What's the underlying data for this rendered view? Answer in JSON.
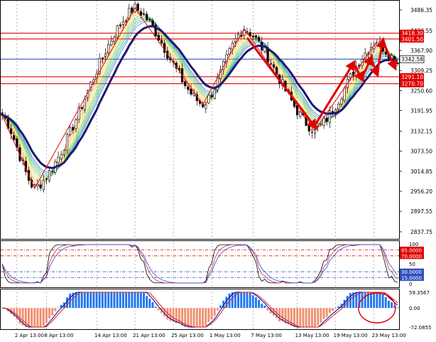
{
  "chart_data": {
    "type": "candlestick",
    "colors": {
      "background": "#ffffff",
      "candle_up": "#ffffff",
      "candle_down": "#000000",
      "candle_outline": "#000000",
      "slow_ma": "#1a1a6e",
      "fan_red": "#e02020",
      "fan_orange": "#ff9a33",
      "fan_yellow": "#e8d13a",
      "fan_green": "#58c24a",
      "fan_teal": "#2ea8a0",
      "fan_blue": "#3d70c8",
      "hline_red": "#e00000",
      "hline_blue": "#3050c0",
      "stoch_main": "#000000",
      "stoch_signal": "#c0304a",
      "stoch_extra": "#4444cc",
      "macd_pos": "#2277ee",
      "macd_neg": "#f09070",
      "macd_line": "#0000aa",
      "macd_signal": "#e02020",
      "annotation": "#e00000"
    },
    "main_panel": {
      "y_ticks": [
        "3486.35",
        "3426.55",
        "3367.90",
        "3309.25",
        "3250.60",
        "3191.95",
        "3132.15",
        "3073.50",
        "3014.85",
        "2956.20",
        "2897.55",
        "2837.75"
      ],
      "price_range": [
        2800,
        3500
      ],
      "horizontal_levels": [
        {
          "label": "3418.30",
          "value": 3418.3,
          "color": "#e00000"
        },
        {
          "label": "3401.50",
          "value": 3401.5,
          "color": "#e00000"
        },
        {
          "label": "3342.58",
          "value": 3342.58,
          "color": "#3050c0"
        },
        {
          "label": "3291.10",
          "value": 3291.1,
          "color": "#e00000"
        },
        {
          "label": "3270.70",
          "value": 3270.7,
          "color": "#e00000"
        }
      ],
      "current_price_label": "3342.58",
      "trend_zigzag": [
        {
          "bar": 0,
          "price": 3178
        },
        {
          "bar": 11,
          "price": 2965
        },
        {
          "bar": 45,
          "price": 3492
        },
        {
          "bar": 68,
          "price": 3210
        },
        {
          "bar": 82,
          "price": 3432
        },
        {
          "bar": 106,
          "price": 3135
        },
        {
          "bar": 127,
          "price": 3395
        }
      ]
    },
    "stoch_panel": {
      "y_ticks": [
        "100",
        "85.0000",
        "70.0000",
        "50",
        "30.0000",
        "15.0000",
        "0"
      ],
      "range": [
        0,
        100
      ],
      "levels": [
        {
          "label": "85.0000",
          "value": 85,
          "color": "#e00000",
          "boxed": true
        },
        {
          "label": "70.0000",
          "value": 70,
          "color": "#e00000",
          "boxed": true
        },
        {
          "label": "30.0000",
          "value": 30,
          "color": "#3050c0",
          "boxed": true
        },
        {
          "label": "15.0000",
          "value": 15,
          "color": "#3050c0",
          "boxed": true
        }
      ]
    },
    "macd_panel": {
      "y_ticks": [
        "59.3567",
        "0.00",
        "-72.0855"
      ],
      "range": [
        -72.0855,
        59.3567
      ]
    },
    "x_ticks": [
      {
        "label": "2 Apr 13:00",
        "bar": 5
      },
      {
        "label": "8 Apr 13:00",
        "bar": 15
      },
      {
        "label": "14 Apr 13:00",
        "bar": 32
      },
      {
        "label": "21 Apr 13:00",
        "bar": 45
      },
      {
        "label": "25 Apr 13:00",
        "bar": 58
      },
      {
        "label": "1 May 13:00",
        "bar": 71
      },
      {
        "label": "7 May 13:00",
        "bar": 85
      },
      {
        "label": "13 May 13:00",
        "bar": 100
      },
      {
        "label": "19 May 13:00",
        "bar": 113
      },
      {
        "label": "23 May 13:00",
        "bar": 126
      }
    ]
  }
}
